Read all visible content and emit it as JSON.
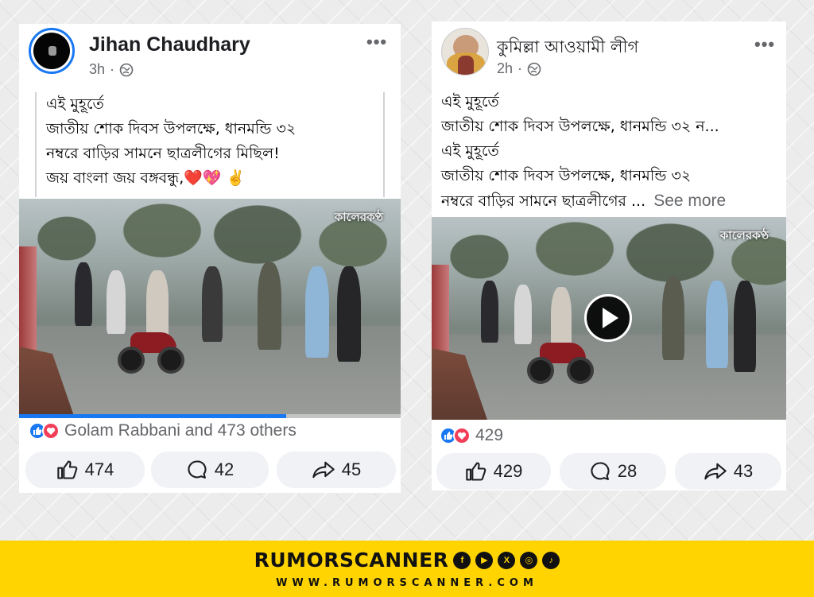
{
  "colors": {
    "fb_blue": "#1877f2",
    "love_red": "#f33e58",
    "footer_yellow": "#ffd400"
  },
  "left_post": {
    "author": "Jihan Chaudhary",
    "time": "3h",
    "visibility_icon": "globe-icon",
    "text_lines": [
      "এই মুহূর্তে",
      "জাতীয় শোক দিবস উপলক্ষে, ধানমন্ডি ৩২",
      "নম্বরে বাড়ির সামনে ছাত্রলীগের মিছিল!",
      "জয় বাংলা জয় বঙ্গবন্ধু,❤️💖 ✌️"
    ],
    "video_watermark": "কালেরকণ্ঠ",
    "video_progress": 0.7,
    "reaction_summary": "Golam Rabbani and 473 others",
    "likes": "474",
    "comments": "42",
    "shares": "45"
  },
  "right_post": {
    "author": "কুমিল্লা আওয়ামী লীগ",
    "time": "2h",
    "visibility_icon": "globe-icon",
    "text_lines": [
      "এই মুহূর্তে",
      "জাতীয় শোক দিবস উপলক্ষে, ধানমন্ডি ৩২ ন...",
      "এই মুহূর্তে",
      "জাতীয় শোক দিবস উপলক্ষে, ধানমন্ডি ৩২",
      "নম্বরে বাড়ির সামনে ছাত্রলীগের ..."
    ],
    "see_more": "See more",
    "video_watermark": "কালেরকণ্ঠ",
    "reaction_count": "429",
    "likes": "429",
    "comments": "28",
    "shares": "43"
  },
  "footer": {
    "brand": "RUMORSCANNER",
    "url": "WWW.RUMORSCANNER.COM",
    "social_icons": [
      "facebook-icon",
      "youtube-icon",
      "x-icon",
      "instagram-icon",
      "tiktok-icon"
    ]
  }
}
